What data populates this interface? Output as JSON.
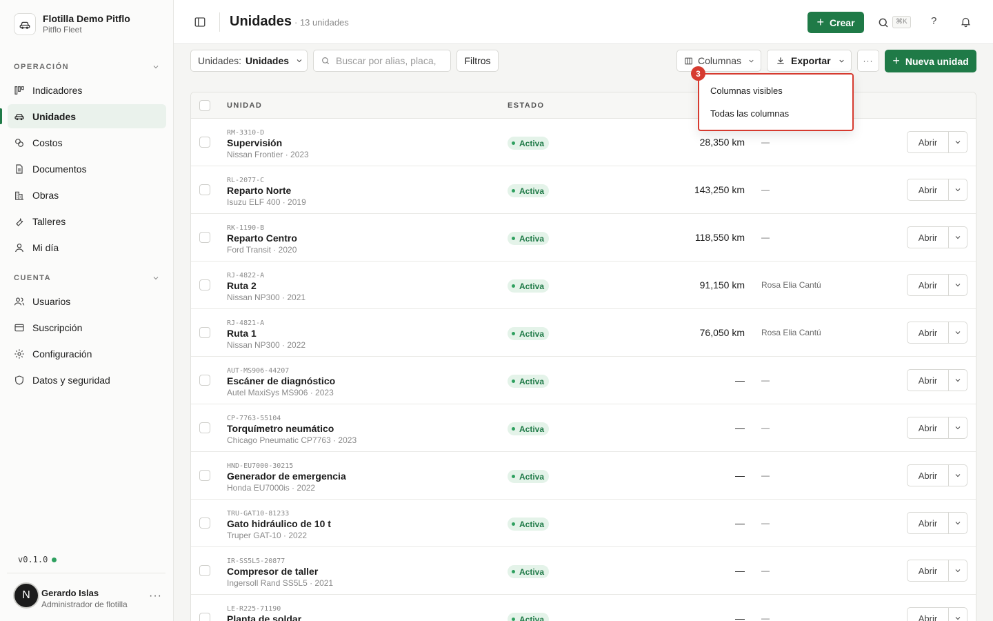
{
  "org": {
    "name": "Flotilla Demo Pitflo",
    "subtitle": "Pitflo Fleet"
  },
  "sidebar": {
    "sections": [
      {
        "title": "OPERACIÓN",
        "items": [
          {
            "label": "Indicadores",
            "icon": "chart-icon",
            "active": false
          },
          {
            "label": "Unidades",
            "icon": "car-icon",
            "active": true
          },
          {
            "label": "Costos",
            "icon": "coins-icon",
            "active": false
          },
          {
            "label": "Documentos",
            "icon": "document-icon",
            "active": false
          },
          {
            "label": "Obras",
            "icon": "building-icon",
            "active": false
          },
          {
            "label": "Talleres",
            "icon": "wrench-icon",
            "active": false
          },
          {
            "label": "Mi día",
            "icon": "user-icon",
            "active": false
          }
        ]
      },
      {
        "title": "CUENTA",
        "items": [
          {
            "label": "Usuarios",
            "icon": "users-icon",
            "active": false
          },
          {
            "label": "Suscripción",
            "icon": "card-icon",
            "active": false
          },
          {
            "label": "Configuración",
            "icon": "gear-icon",
            "active": false
          },
          {
            "label": "Datos y seguridad",
            "icon": "shield-icon",
            "active": false
          }
        ]
      }
    ],
    "version": "v0.1.0",
    "user": {
      "initial": "N",
      "name": "Gerardo Islas",
      "role": "Administrador de flotilla"
    }
  },
  "header": {
    "title": "Unidades",
    "count": "· 13 unidades",
    "create_label": "Crear",
    "kbd": "⌘K",
    "help": "?"
  },
  "toolbar": {
    "view_label": "Unidades:",
    "view_value": "Unidades",
    "search_placeholder": "Buscar por alias, placa,",
    "filters_label": "Filtros",
    "columns_label": "Columnas",
    "export_label": "Exportar",
    "more_label": "···",
    "new_label": "Nueva unidad"
  },
  "table": {
    "headers": {
      "unit": "UNIDAD",
      "status": "ESTADO"
    },
    "open_label": "Abrir",
    "rows": [
      {
        "code": "RM-3310-D",
        "alias": "Supervisión",
        "model": "Nissan Frontier · 2023",
        "status": "Activa",
        "km": "28,350 km",
        "driver": "—"
      },
      {
        "code": "RL-2077-C",
        "alias": "Reparto Norte",
        "model": "Isuzu ELF 400 · 2019",
        "status": "Activa",
        "km": "143,250 km",
        "driver": "—"
      },
      {
        "code": "RK-1190-B",
        "alias": "Reparto Centro",
        "model": "Ford Transit · 2020",
        "status": "Activa",
        "km": "118,550 km",
        "driver": "—"
      },
      {
        "code": "RJ-4822-A",
        "alias": "Ruta 2",
        "model": "Nissan NP300 · 2021",
        "status": "Activa",
        "km": "91,150 km",
        "driver": "Rosa Elia Cantú"
      },
      {
        "code": "RJ-4821-A",
        "alias": "Ruta 1",
        "model": "Nissan NP300 · 2022",
        "status": "Activa",
        "km": "76,050 km",
        "driver": "Rosa Elia Cantú"
      },
      {
        "code": "AUT-MS906-44207",
        "alias": "Escáner de diagnóstico",
        "model": "Autel MaxiSys MS906 · 2023",
        "status": "Activa",
        "km": "—",
        "driver": "—"
      },
      {
        "code": "CP-7763-55104",
        "alias": "Torquímetro neumático",
        "model": "Chicago Pneumatic CP7763 · 2023",
        "status": "Activa",
        "km": "—",
        "driver": "—"
      },
      {
        "code": "HND-EU7000-30215",
        "alias": "Generador de emergencia",
        "model": "Honda EU7000is · 2022",
        "status": "Activa",
        "km": "—",
        "driver": "—"
      },
      {
        "code": "TRU-GAT10-81233",
        "alias": "Gato hidráulico de 10 t",
        "model": "Truper GAT-10 · 2022",
        "status": "Activa",
        "km": "—",
        "driver": "—"
      },
      {
        "code": "IR-SS5L5-20877",
        "alias": "Compresor de taller",
        "model": "Ingersoll Rand SS5L5 · 2021",
        "status": "Activa",
        "km": "—",
        "driver": "—"
      },
      {
        "code": "LE-R225-71190",
        "alias": "Planta de soldar",
        "model": "",
        "status": "Activa",
        "km": "—",
        "driver": "—"
      }
    ]
  },
  "columns_menu": {
    "step": "3",
    "items": [
      "Columnas visibles",
      "Todas las columnas"
    ]
  },
  "colors": {
    "accent": "#1f7a47",
    "highlight": "#d63a2f"
  }
}
